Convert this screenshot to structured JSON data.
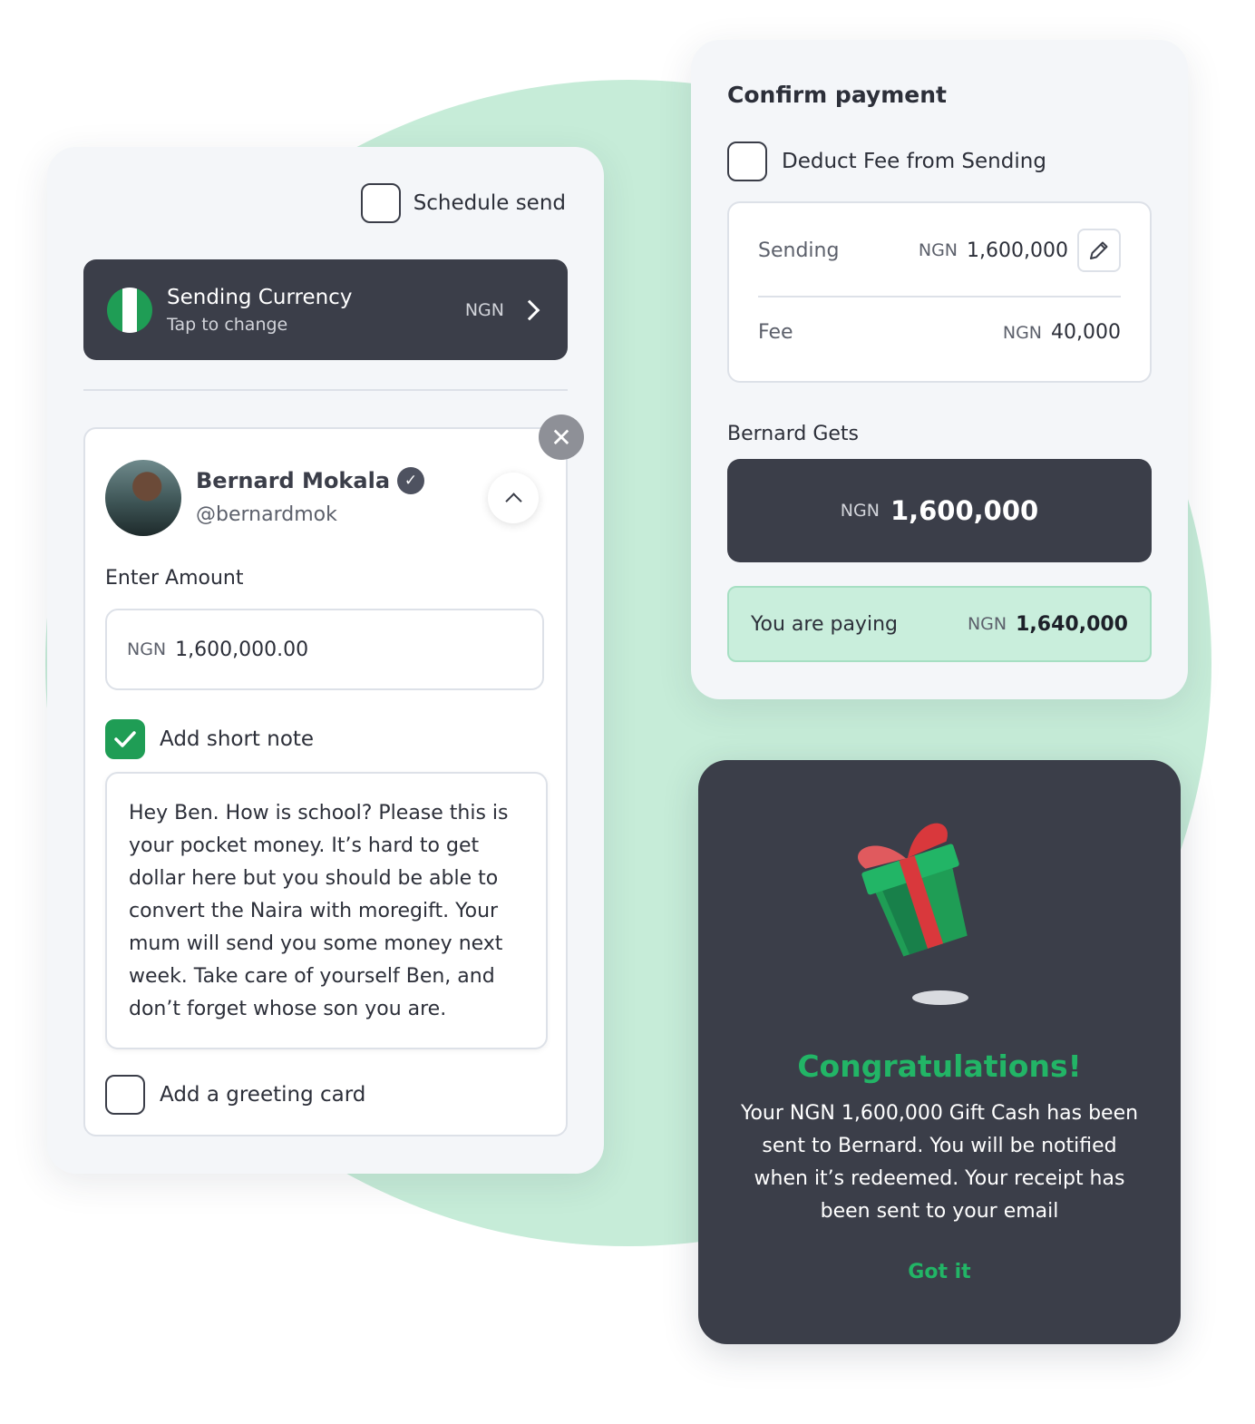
{
  "colors": {
    "brand_green": "#1f9d55",
    "accent_green": "#22b566",
    "dark_panel": "#3b3e49",
    "mint_background": "#c6ecd8",
    "flag_green": "#1f9d55",
    "flag_white": "#ffffff"
  },
  "schedule": {
    "label": "Schedule send",
    "checked": false
  },
  "currency": {
    "title": "Sending Currency",
    "subtitle": "Tap to change",
    "code": "NGN",
    "flag_icon": "nigeria-flag-icon"
  },
  "recipient": {
    "name": "Bernard Mokala",
    "handle": "@bernardmok",
    "amount_label": "Enter Amount",
    "amount_currency": "NGN",
    "amount_value": "1,600,000.00",
    "note_label": "Add short note",
    "note_checked": true,
    "note_text": "Hey Ben. How is school? Please this is your pocket money. It’s hard to get dollar here but you should be able to convert the Naira with moregift. Your mum will send you some money next week. Take care of yourself Ben, and don’t forget whose son you are.",
    "greeting_label": "Add a greeting card",
    "greeting_checked": false
  },
  "confirm": {
    "title": "Confirm payment",
    "deduct_label": "Deduct Fee from Sending",
    "deduct_checked": false,
    "sending_label": "Sending",
    "sending_currency": "NGN",
    "sending_value": "1,600,000",
    "fee_label": "Fee",
    "fee_currency": "NGN",
    "fee_value": "40,000",
    "gets_label": "Bernard Gets",
    "gets_currency": "NGN",
    "gets_value": "1,600,000",
    "paying_label": "You are paying",
    "paying_currency": "NGN",
    "paying_value": "1,640,000"
  },
  "success": {
    "title": "Congratulations!",
    "message": "Your NGN 1,600,000 Gift Cash has been sent to Bernard. You will be notified when it’s redeemed. Your receipt has been sent to your email",
    "button": "Got it",
    "illustration": "gift-box-icon"
  }
}
